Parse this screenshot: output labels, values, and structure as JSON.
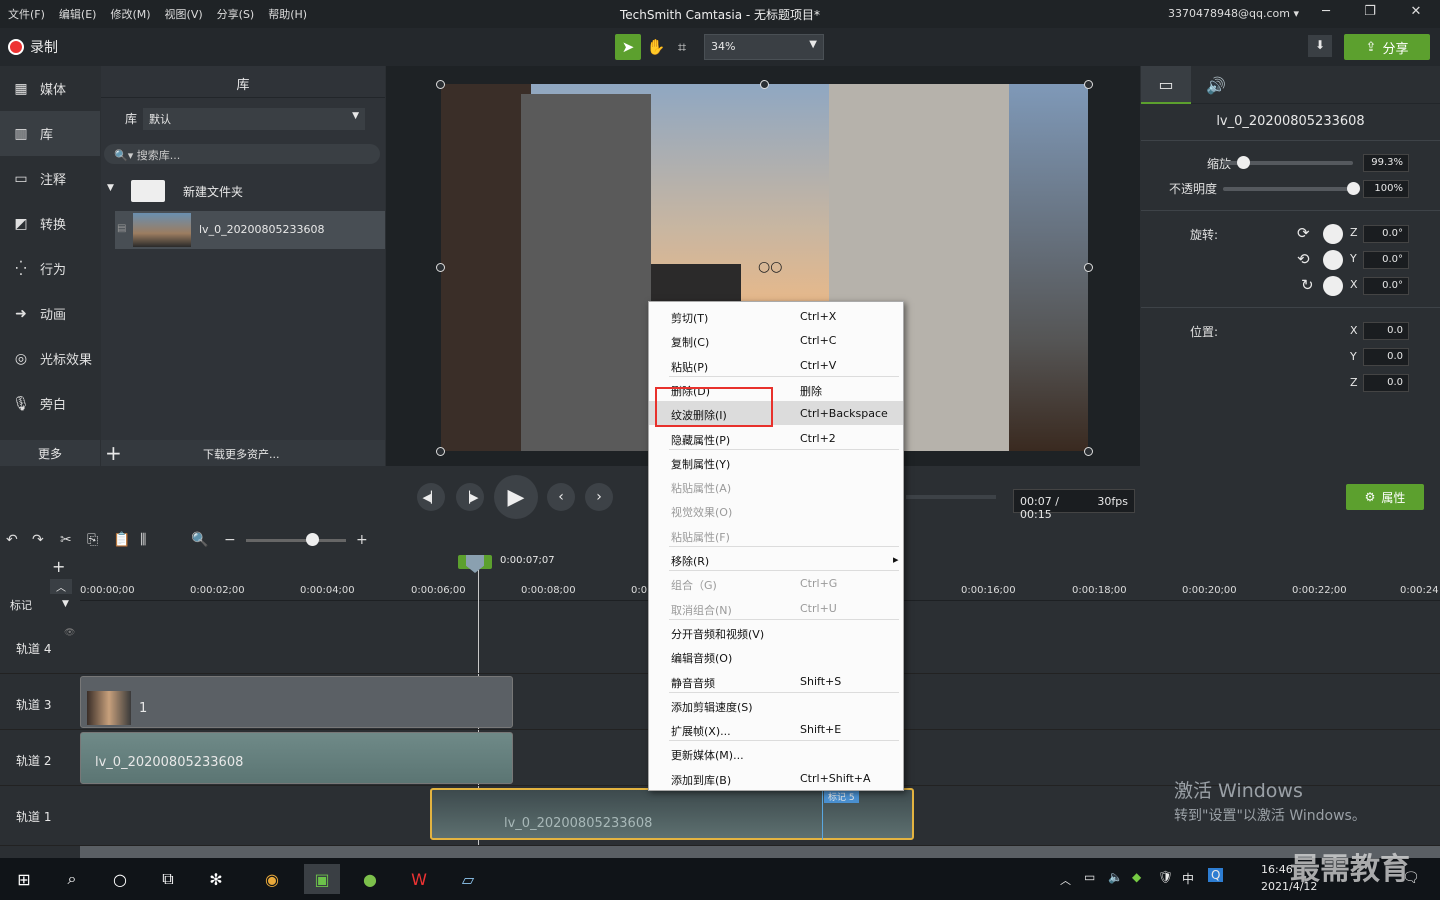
{
  "window": {
    "title": "TechSmith Camtasia - 无标题项目*",
    "account": "3370478948@qq.com",
    "menus": [
      "文件(F)",
      "编辑(E)",
      "修改(M)",
      "视图(V)",
      "分享(S)",
      "帮助(H)"
    ]
  },
  "toolbar": {
    "record": "录制",
    "zoom": "34%",
    "share": "分享"
  },
  "sidebar": {
    "items": [
      "媒体",
      "库",
      "注释",
      "转换",
      "行为",
      "动画",
      "光标效果",
      "旁白"
    ],
    "more": "更多"
  },
  "library": {
    "title": "库",
    "lib_label": "库",
    "lib_value": "默认",
    "search_placeholder": "搜索库...",
    "folder": "新建文件夹",
    "media": "lv_0_20200805233608",
    "download": "下载更多资产..."
  },
  "props": {
    "clip_name": "lv_0_20200805233608",
    "scale_label": "缩放",
    "scale_val": "99.3%",
    "opacity_label": "不透明度",
    "opacity_val": "100%",
    "rotation_label": "旋转:",
    "rot_z": "0.0°",
    "rot_y": "0.0°",
    "rot_x": "0.0°",
    "position_label": "位置:",
    "pos_x": "0.0",
    "pos_y": "0.0",
    "pos_z": "0.0",
    "axis_z": "Z",
    "axis_y": "Y",
    "axis_x": "X",
    "button": "属性",
    "scale_fraction": 0.15,
    "opacity_fraction": 1.0
  },
  "playback": {
    "time": "00:07 / 00:15",
    "fps": "30fps"
  },
  "timeline": {
    "playhead": "0:00:07;07",
    "marker_label": "标记",
    "ticks": [
      "0:00:00;00",
      "0:00:02;00",
      "0:00:04;00",
      "0:00:06;00",
      "0:00:08;00",
      "0:0",
      "0:00:16;00",
      "0:00:18;00",
      "0:00:20;00",
      "0:00:22;00",
      "0:00:24"
    ],
    "tracks": [
      "轨道 4",
      "轨道 3",
      "轨道 2",
      "轨道 1"
    ],
    "clip3": "1",
    "clip2": "lv_0_20200805233608",
    "clip1": "lv_0_20200805233608",
    "flag": "标记 5"
  },
  "context_menu": [
    {
      "label": "剪切(T)",
      "shortcut": "Ctrl+X",
      "enabled": true
    },
    {
      "label": "复制(C)",
      "shortcut": "Ctrl+C",
      "enabled": true
    },
    {
      "label": "粘贴(P)",
      "shortcut": "Ctrl+V",
      "enabled": true
    },
    {
      "label": "删除(D)",
      "shortcut": "删除",
      "enabled": true
    },
    {
      "label": "纹波删除(I)",
      "shortcut": "Ctrl+Backspace",
      "enabled": true
    },
    {
      "label": "隐藏属性(P)",
      "shortcut": "Ctrl+2",
      "enabled": true
    },
    {
      "label": "复制属性(Y)",
      "shortcut": "",
      "enabled": true
    },
    {
      "label": "粘贴属性(A)",
      "shortcut": "",
      "enabled": false
    },
    {
      "label": "视觉效果(O)",
      "shortcut": "",
      "enabled": false
    },
    {
      "label": "粘贴属性(F)",
      "shortcut": "",
      "enabled": false
    },
    {
      "label": "移除(R)",
      "shortcut": "",
      "enabled": true,
      "submenu": true
    },
    {
      "label": "组合（G)",
      "shortcut": "Ctrl+G",
      "enabled": false
    },
    {
      "label": "取消组合(N)",
      "shortcut": "Ctrl+U",
      "enabled": false
    },
    {
      "label": "分开音频和视频(V)",
      "shortcut": "",
      "enabled": true
    },
    {
      "label": "编辑音频(O)",
      "shortcut": "",
      "enabled": true
    },
    {
      "label": "静音音频",
      "shortcut": "Shift+S",
      "enabled": true
    },
    {
      "label": "添加剪辑速度(S)",
      "shortcut": "",
      "enabled": true
    },
    {
      "label": "扩展帧(X)...",
      "shortcut": "Shift+E",
      "enabled": true
    },
    {
      "label": "更新媒体(M)...",
      "shortcut": "",
      "enabled": true
    },
    {
      "label": "添加到库(B)",
      "shortcut": "Ctrl+Shift+A",
      "enabled": true
    }
  ],
  "watermark": {
    "line1": "激活 Windows",
    "line2": "转到\"设置\"以激活 Windows。"
  },
  "taskbar": {
    "time": "16:46",
    "date": "2021/4/12",
    "ime": "中",
    "brand": "最需教育"
  }
}
